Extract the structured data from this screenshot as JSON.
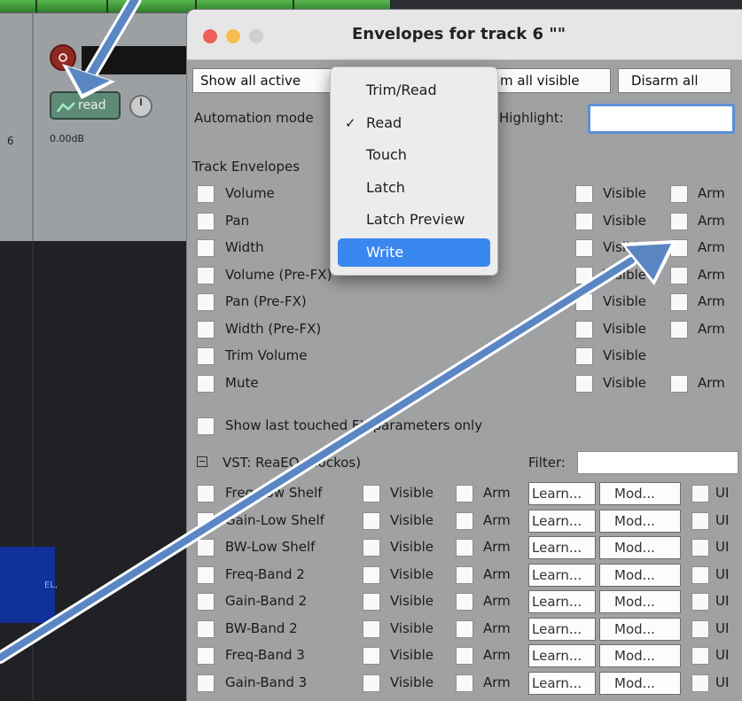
{
  "track": {
    "number": "6",
    "auto_label": "read",
    "volume": "0.00dB",
    "blue_box_text": "EL,"
  },
  "window": {
    "title": "Envelopes for track 6 \"\"",
    "buttons": {
      "show_all_active": "Show all active",
      "arm_all_visible": "m all visible",
      "disarm_all": "Disarm all"
    },
    "automation_mode_label": "Automation mode",
    "highlight_label": "Highlight:",
    "track_envelopes_label": "Track Envelopes",
    "visible_label": "Visible",
    "arm_label": "Arm",
    "track_envelopes": [
      {
        "name": "Volume",
        "has_arm": true
      },
      {
        "name": "Pan",
        "has_arm": true
      },
      {
        "name": "Width",
        "has_arm": true
      },
      {
        "name": "Volume (Pre-FX)",
        "has_arm": true
      },
      {
        "name": "Pan (Pre-FX)",
        "has_arm": true
      },
      {
        "name": "Width (Pre-FX)",
        "has_arm": true
      },
      {
        "name": "Trim Volume",
        "has_arm": false
      },
      {
        "name": "Mute",
        "has_arm": true
      }
    ],
    "show_last_touched": "Show last touched FX parameters only",
    "plugin_label": "VST: ReaEQ (Cockos)",
    "filter_label": "Filter:",
    "fx_params": [
      {
        "name": "Freq-Low Shelf"
      },
      {
        "name": "Gain-Low Shelf"
      },
      {
        "name": "BW-Low Shelf"
      },
      {
        "name": "Freq-Band 2"
      },
      {
        "name": "Gain-Band 2"
      },
      {
        "name": "BW-Band 2"
      },
      {
        "name": "Freq-Band 3"
      },
      {
        "name": "Gain-Band 3"
      }
    ],
    "fx_buttons": {
      "learn": "Learn...",
      "mod": "Mod...",
      "ui": "UI"
    }
  },
  "automation_menu": {
    "items": [
      {
        "label": "Trim/Read",
        "checked": false,
        "selected": false
      },
      {
        "label": "Read",
        "checked": true,
        "selected": false
      },
      {
        "label": "Touch",
        "checked": false,
        "selected": false
      },
      {
        "label": "Latch",
        "checked": false,
        "selected": false
      },
      {
        "label": "Latch Preview",
        "checked": false,
        "selected": false
      },
      {
        "label": "Write",
        "checked": false,
        "selected": true
      }
    ]
  },
  "colors": {
    "arrow": "#5b86c4",
    "menu_selection": "#3b87f0",
    "highlight_border": "#5b8fd6"
  }
}
